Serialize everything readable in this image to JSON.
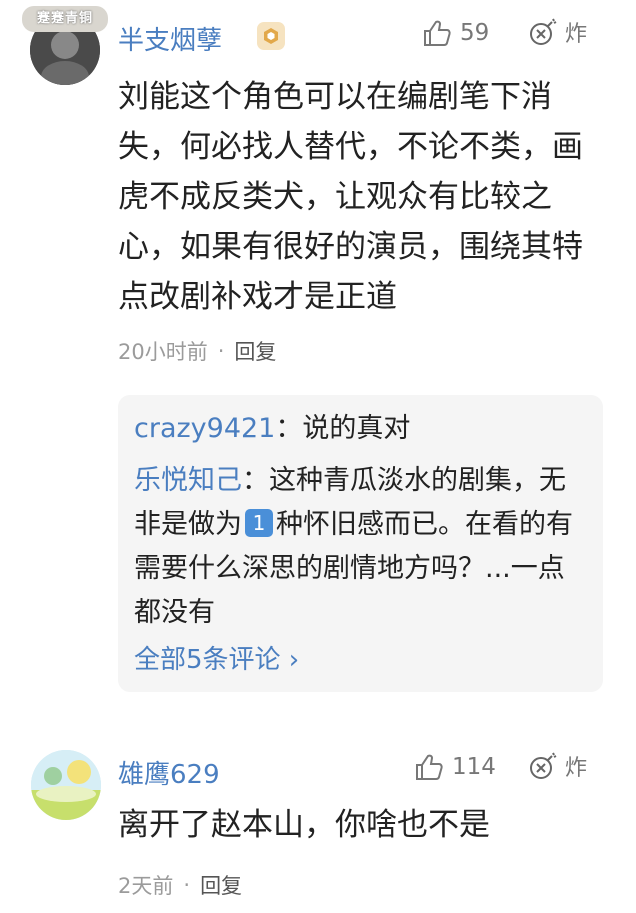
{
  "comments": [
    {
      "avatar_tag": "蹇蹇青铜",
      "username": "半支烟孽",
      "like_count": "59",
      "boom_label": "炸",
      "text": "刘能这个角色可以在编剧笔下消失，何必找人替代，不论不类，画虎不成反类犬，让观众有比较之心，如果有很好的演员，围绕其特点改剧补戏才是正道",
      "time": "20小时前",
      "reply_label": "回复",
      "replies": [
        {
          "user": "crazy9421",
          "text": "：说的真对"
        },
        {
          "user": "乐悦知己",
          "text_before": "：这种青瓜淡水的剧集，无非是做为",
          "number_icon": "1",
          "text_after": "种怀旧感而已。在看的有需要什么深思的剧情地方吗？...一点都没有"
        }
      ],
      "view_all": "全部5条评论 ›"
    },
    {
      "username": "雄鹰629",
      "like_count": "114",
      "boom_label": "炸",
      "text": "离开了赵本山，你啥也不是",
      "time": "2天前",
      "reply_label": "回复"
    }
  ]
}
